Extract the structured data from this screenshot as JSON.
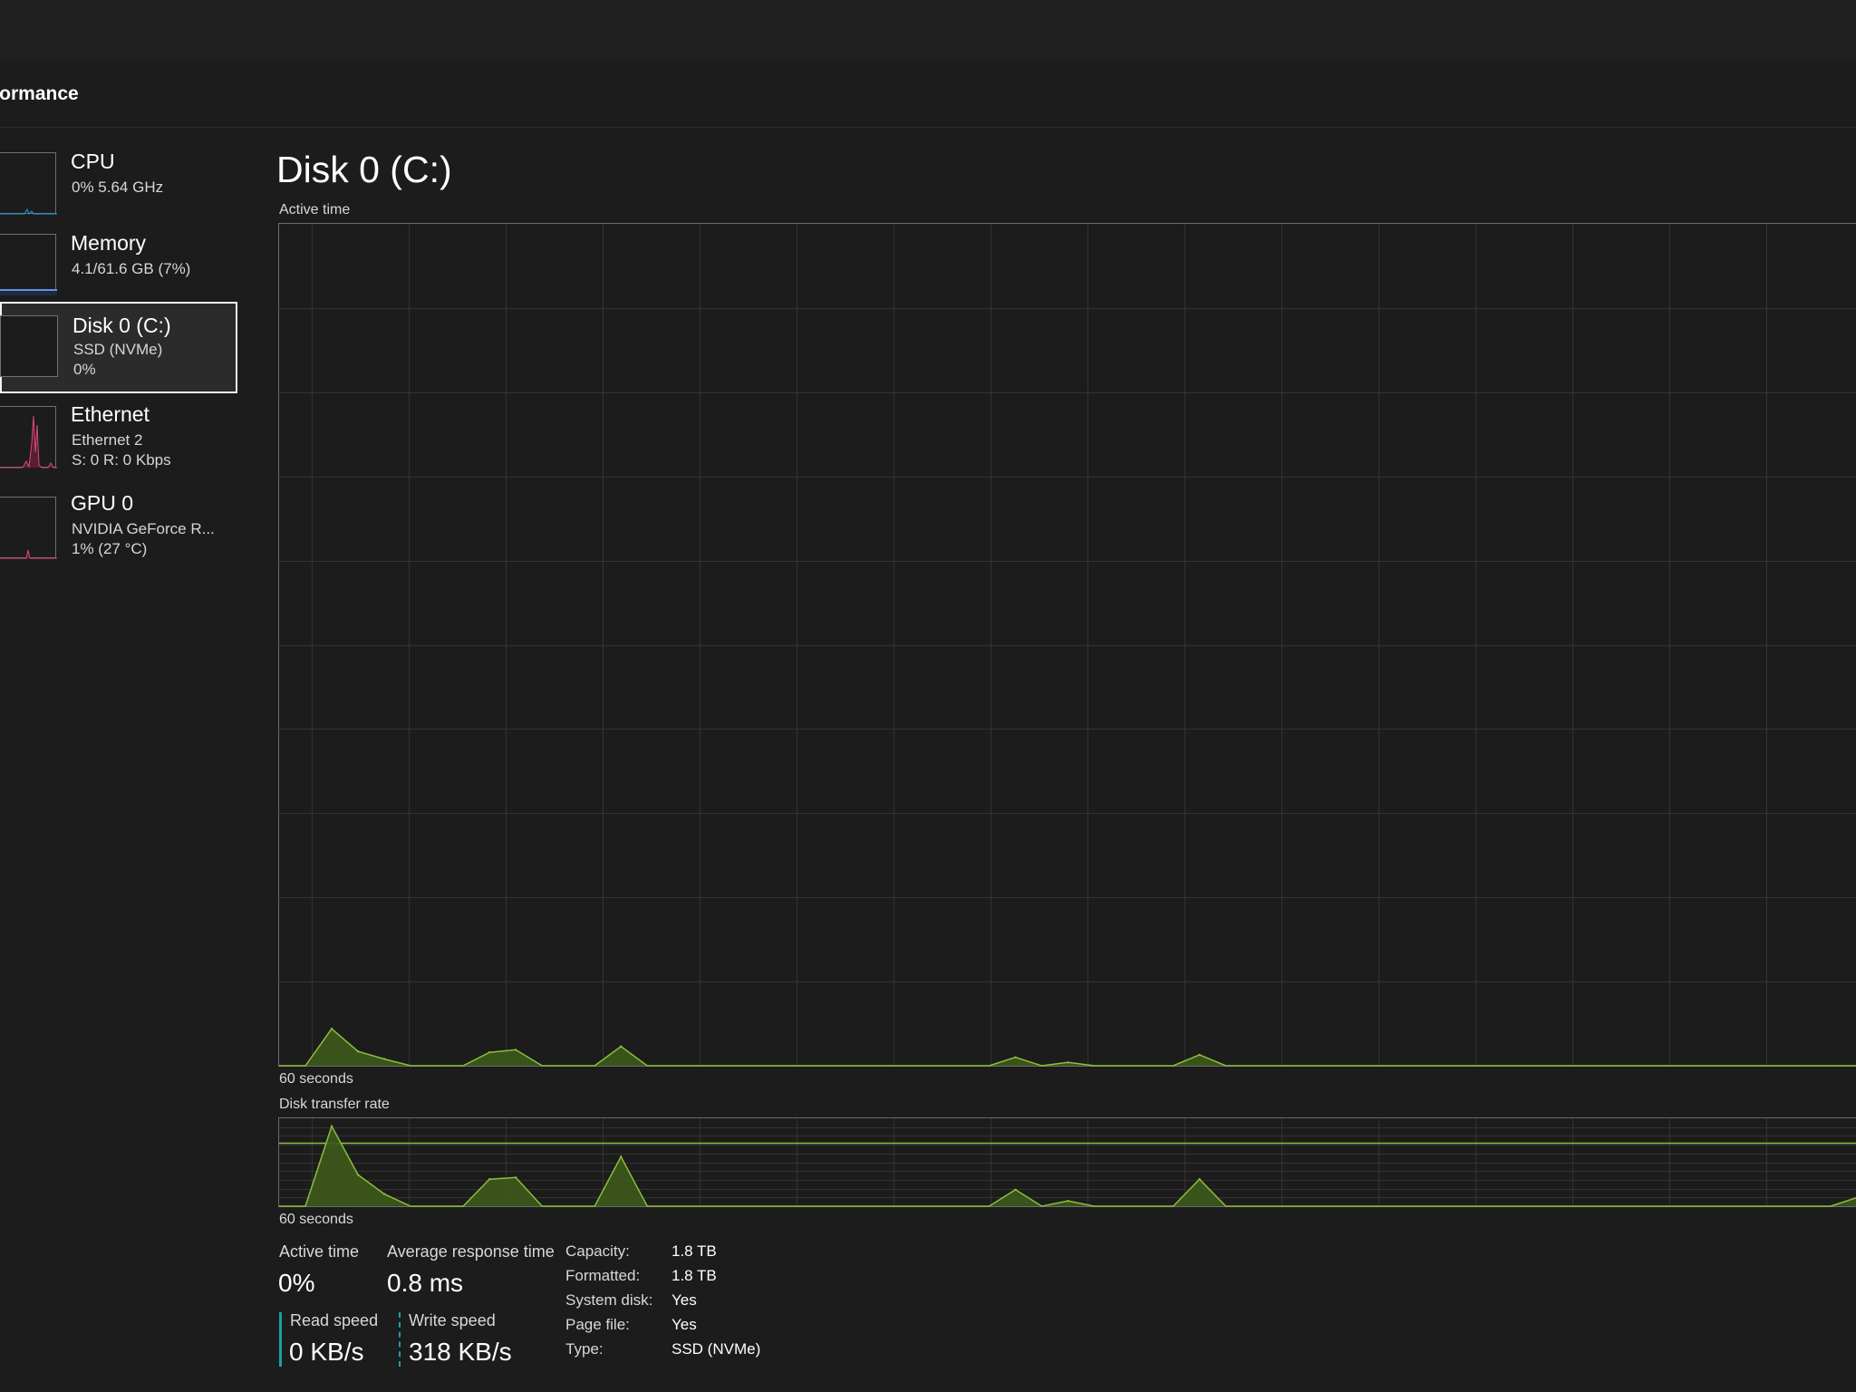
{
  "header": {
    "title": "rformance"
  },
  "sidebar": {
    "items": [
      {
        "title": "CPU",
        "line1": "0%  5.64 GHz",
        "line2": "",
        "color": "#1aa0d8"
      },
      {
        "title": "Memory",
        "line1": "4.1/61.6 GB (7%)",
        "line2": "",
        "color": "#6a8fe0"
      },
      {
        "title": "Disk 0 (C:)",
        "line1": "SSD (NVMe)",
        "line2": "0%",
        "color": "#7fb03a",
        "selected": true
      },
      {
        "title": "Ethernet",
        "line1": "Ethernet 2",
        "line2": "S: 0  R: 0 Kbps",
        "color": "#d9497a"
      },
      {
        "title": "GPU 0",
        "line1": "NVIDIA GeForce R...",
        "line2": "1%  (27 °C)",
        "color": "#d9497a"
      }
    ]
  },
  "main": {
    "title": "Disk 0 (C:)",
    "active_chart": {
      "label": "Active time",
      "duration_label": "60 seconds"
    },
    "transfer_chart": {
      "label": "Disk transfer rate",
      "duration_label": "60 seconds"
    },
    "stats": {
      "active_time_label": "Active time",
      "active_time_value": "0%",
      "avg_response_label": "Average response time",
      "avg_response_value": "0.8 ms",
      "read_speed_label": "Read speed",
      "read_speed_value": "0 KB/s",
      "write_speed_label": "Write speed",
      "write_speed_value": "318 KB/s"
    },
    "properties": [
      {
        "label": "Capacity:",
        "value": "1.8 TB"
      },
      {
        "label": "Formatted:",
        "value": "1.8 TB"
      },
      {
        "label": "System disk:",
        "value": "Yes"
      },
      {
        "label": "Page file:",
        "value": "Yes"
      },
      {
        "label": "Type:",
        "value": "SSD (NVMe)"
      }
    ]
  },
  "colors": {
    "disk_accent": "#8bbf3c",
    "disk_fill": "#3d5a1c",
    "read_color": "#1aa0a8",
    "grid": "#333333"
  },
  "chart_data": [
    {
      "type": "area",
      "title": "Active time",
      "xlabel": "60 seconds",
      "x": [
        0,
        1,
        2,
        3,
        4,
        5,
        6,
        7,
        8,
        9,
        10,
        11,
        12,
        13,
        14,
        15,
        16,
        17,
        18,
        19,
        20,
        21,
        22,
        23,
        24,
        25,
        26,
        27,
        28,
        29,
        30,
        31,
        32,
        33,
        34,
        35,
        36,
        37,
        38,
        39,
        40,
        41,
        42,
        43,
        44,
        45,
        46,
        47,
        48,
        49,
        50,
        51,
        52,
        53,
        54,
        55,
        56,
        57,
        58,
        59,
        60
      ],
      "series": [
        {
          "values": [
            0,
            0,
            4.4,
            1.7,
            0.8,
            0,
            0,
            0,
            1.6,
            1.9,
            0,
            0,
            0,
            2.3,
            0,
            0,
            0,
            0,
            0,
            0,
            0,
            0,
            0,
            0,
            0,
            0,
            0,
            0,
            1.0,
            0,
            0.4,
            0,
            0,
            0,
            0,
            1.3,
            0,
            0,
            0,
            0,
            0,
            0,
            0,
            0,
            0,
            0,
            0,
            0,
            0,
            0,
            0,
            0,
            0,
            0,
            0,
            0,
            0,
            0,
            0,
            0,
            0
          ]
        }
      ],
      "ylim": [
        0,
        100
      ]
    },
    {
      "type": "area",
      "title": "Disk transfer rate",
      "xlabel": "60 seconds",
      "x": [
        0,
        1,
        2,
        3,
        4,
        5,
        6,
        7,
        8,
        9,
        10,
        11,
        12,
        13,
        14,
        15,
        16,
        17,
        18,
        19,
        20,
        21,
        22,
        23,
        24,
        25,
        26,
        27,
        28,
        29,
        30,
        31,
        32,
        33,
        34,
        35,
        36,
        37,
        38,
        39,
        40,
        41,
        42,
        43,
        44,
        45,
        46,
        47,
        48,
        49,
        50,
        51,
        52,
        53,
        54,
        55,
        56,
        57,
        58,
        59,
        60
      ],
      "series": [
        {
          "values": [
            0,
            0,
            92,
            36,
            14,
            0,
            0,
            0,
            31,
            33,
            0,
            0,
            0,
            57,
            0,
            0,
            0,
            0,
            0,
            0,
            0,
            0,
            0,
            0,
            0,
            0,
            0,
            0,
            19,
            0,
            6,
            0,
            0,
            0,
            0,
            31,
            0,
            0,
            0,
            0,
            0,
            0,
            0,
            0,
            0,
            0,
            0,
            0,
            0,
            0,
            0,
            0,
            0,
            0,
            0,
            0,
            0,
            0,
            0,
            0,
            10
          ]
        }
      ],
      "ylim": [
        0,
        100
      ]
    }
  ]
}
